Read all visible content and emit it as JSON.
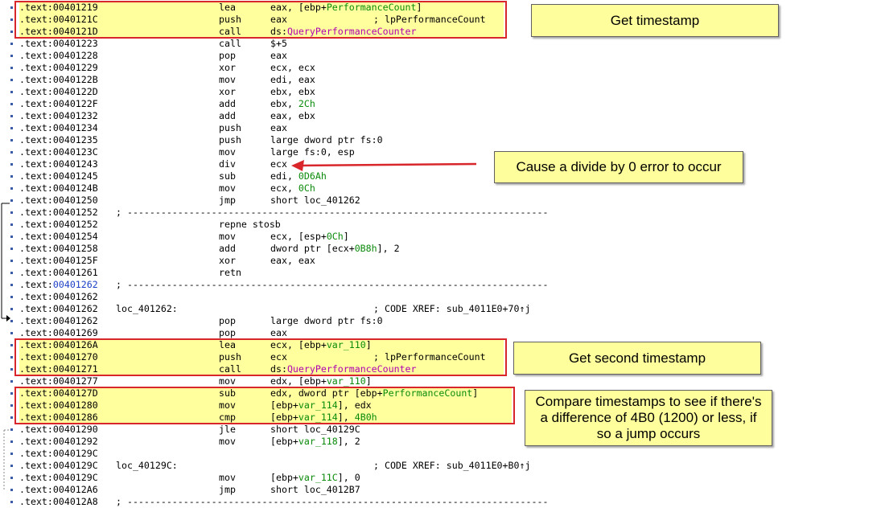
{
  "listing": [
    {
      "addr": "00401219",
      "mnem": "lea",
      "ops": [
        {
          "t": "eax, [ebp+"
        },
        {
          "t": "PerformanceCount",
          "c": "var"
        },
        {
          "t": "]"
        }
      ],
      "hl": true
    },
    {
      "addr": "0040121C",
      "mnem": "push",
      "ops": [
        {
          "t": "eax"
        }
      ],
      "comment": "; lpPerformanceCount",
      "hl": true
    },
    {
      "addr": "0040121D",
      "mnem": "call",
      "ops": [
        {
          "t": "ds:"
        },
        {
          "t": "QueryPerformanceCounter",
          "c": "api"
        }
      ],
      "hl": true
    },
    {
      "addr": "00401223",
      "mnem": "call",
      "ops": [
        {
          "t": "$+5"
        }
      ]
    },
    {
      "addr": "00401228",
      "mnem": "pop",
      "ops": [
        {
          "t": "eax"
        }
      ]
    },
    {
      "addr": "00401229",
      "mnem": "xor",
      "ops": [
        {
          "t": "ecx, ecx"
        }
      ]
    },
    {
      "addr": "0040122B",
      "mnem": "mov",
      "ops": [
        {
          "t": "edi, eax"
        }
      ]
    },
    {
      "addr": "0040122D",
      "mnem": "xor",
      "ops": [
        {
          "t": "ebx, ebx"
        }
      ]
    },
    {
      "addr": "0040122F",
      "mnem": "add",
      "ops": [
        {
          "t": "ebx, "
        },
        {
          "t": "2Ch",
          "c": "num"
        }
      ]
    },
    {
      "addr": "00401232",
      "mnem": "add",
      "ops": [
        {
          "t": "eax, ebx"
        }
      ]
    },
    {
      "addr": "00401234",
      "mnem": "push",
      "ops": [
        {
          "t": "eax"
        }
      ]
    },
    {
      "addr": "00401235",
      "mnem": "push",
      "ops": [
        {
          "t": "large dword ptr fs:0"
        }
      ]
    },
    {
      "addr": "0040123C",
      "mnem": "mov",
      "ops": [
        {
          "t": "large fs:0, esp"
        }
      ]
    },
    {
      "addr": "00401243",
      "mnem": "div",
      "ops": [
        {
          "t": "ecx"
        }
      ]
    },
    {
      "addr": "00401245",
      "mnem": "sub",
      "ops": [
        {
          "t": "edi, "
        },
        {
          "t": "0D6Ah",
          "c": "num"
        }
      ]
    },
    {
      "addr": "0040124B",
      "mnem": "mov",
      "ops": [
        {
          "t": "ecx, "
        },
        {
          "t": "0Ch",
          "c": "num"
        }
      ]
    },
    {
      "addr": "00401250",
      "mnem": "jmp",
      "ops": [
        {
          "t": "short loc_401262"
        }
      ]
    },
    {
      "addr": "00401252",
      "sep": "; ---------------------------------------------------------------------------"
    },
    {
      "addr": "00401252",
      "mnem": "repne stosb",
      "ops": []
    },
    {
      "addr": "00401254",
      "mnem": "mov",
      "ops": [
        {
          "t": "ecx, [esp+"
        },
        {
          "t": "0Ch",
          "c": "num"
        },
        {
          "t": "]"
        }
      ]
    },
    {
      "addr": "00401258",
      "mnem": "add",
      "ops": [
        {
          "t": "dword ptr [ecx+"
        },
        {
          "t": "0B8h",
          "c": "num"
        },
        {
          "t": "], 2"
        }
      ]
    },
    {
      "addr": "0040125F",
      "mnem": "xor",
      "ops": [
        {
          "t": "eax, eax"
        }
      ]
    },
    {
      "addr": "00401261",
      "mnem": "retn",
      "ops": []
    },
    {
      "addr": "00401262",
      "sep": "; ---------------------------------------------------------------------------",
      "blue": true
    },
    {
      "addr": "00401262"
    },
    {
      "addr": "00401262",
      "label": "loc_401262:",
      "comment": "; CODE XREF: sub_4011E0+70↑j"
    },
    {
      "addr": "00401262",
      "mnem": "pop",
      "ops": [
        {
          "t": "large dword ptr fs:0"
        }
      ]
    },
    {
      "addr": "00401269",
      "mnem": "pop",
      "ops": [
        {
          "t": "eax"
        }
      ]
    },
    {
      "addr": "0040126A",
      "mnem": "lea",
      "ops": [
        {
          "t": "ecx, [ebp+"
        },
        {
          "t": "var_110",
          "c": "var"
        },
        {
          "t": "]"
        }
      ],
      "hl": true
    },
    {
      "addr": "00401270",
      "mnem": "push",
      "ops": [
        {
          "t": "ecx"
        }
      ],
      "comment": "; lpPerformanceCount",
      "hl": true
    },
    {
      "addr": "00401271",
      "mnem": "call",
      "ops": [
        {
          "t": "ds:"
        },
        {
          "t": "QueryPerformanceCounter",
          "c": "api"
        }
      ],
      "hl": true
    },
    {
      "addr": "00401277",
      "mnem": "mov",
      "ops": [
        {
          "t": "edx, [ebp+"
        },
        {
          "t": "var_110",
          "c": "var"
        },
        {
          "t": "]"
        }
      ]
    },
    {
      "addr": "0040127D",
      "mnem": "sub",
      "ops": [
        {
          "t": "edx, dword ptr [ebp+"
        },
        {
          "t": "PerformanceCount",
          "c": "var"
        },
        {
          "t": "]"
        }
      ],
      "hl": true
    },
    {
      "addr": "00401280",
      "mnem": "mov",
      "ops": [
        {
          "t": "[ebp+"
        },
        {
          "t": "var_114",
          "c": "var"
        },
        {
          "t": "], edx"
        }
      ],
      "hl": true
    },
    {
      "addr": "00401286",
      "mnem": "cmp",
      "ops": [
        {
          "t": "[ebp+"
        },
        {
          "t": "var_114",
          "c": "var"
        },
        {
          "t": "], "
        },
        {
          "t": "4B0h",
          "c": "num"
        }
      ],
      "hl": true
    },
    {
      "addr": "00401290",
      "mnem": "jle",
      "ops": [
        {
          "t": "short loc_40129C"
        }
      ]
    },
    {
      "addr": "00401292",
      "mnem": "mov",
      "ops": [
        {
          "t": "[ebp+"
        },
        {
          "t": "var_118",
          "c": "var"
        },
        {
          "t": "], 2"
        }
      ]
    },
    {
      "addr": "0040129C"
    },
    {
      "addr": "0040129C",
      "label": "loc_40129C:",
      "comment": "; CODE XREF: sub_4011E0+B0↑j"
    },
    {
      "addr": "0040129C",
      "mnem": "mov",
      "ops": [
        {
          "t": "[ebp+"
        },
        {
          "t": "var_11C",
          "c": "var"
        },
        {
          "t": "], 0"
        }
      ]
    },
    {
      "addr": "004012A6",
      "mnem": "jmp",
      "ops": [
        {
          "t": "short loc_4012B7"
        }
      ]
    },
    {
      "addr": "004012A8",
      "sep": "; ---------------------------------------------------------------------------"
    }
  ],
  "segment_prefix": ".text:",
  "annotations": {
    "get_timestamp": "Get timestamp",
    "divide_by_zero": "Cause a divide by 0 error to occur",
    "get_second_timestamp": "Get second timestamp",
    "compare_timestamps": "Compare timestamps to see if there's a difference of 4B0 (1200) or less, if so a jump occurs"
  },
  "colors": {
    "highlight": "#ffff9e",
    "box_border": "#d8262a",
    "note_bg": "#fefe9c",
    "name_color": "#0a8a0a",
    "api_color": "#b000b0",
    "arrow": "#d8262a"
  }
}
